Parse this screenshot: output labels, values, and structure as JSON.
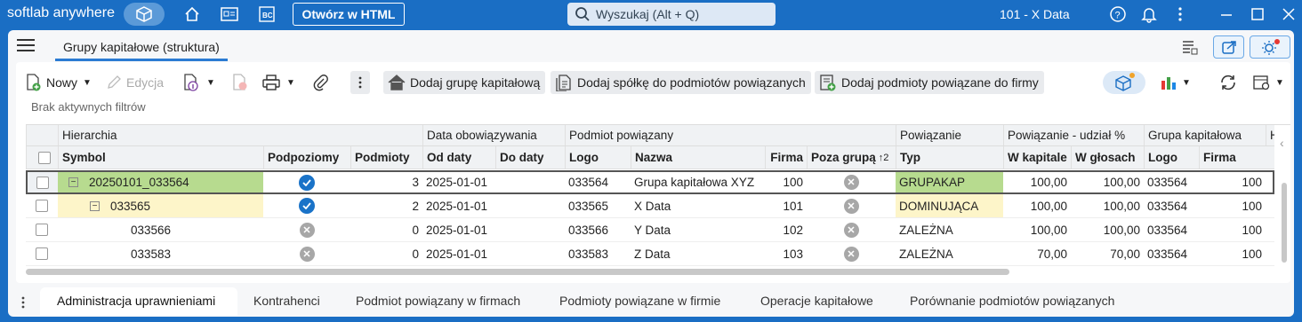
{
  "titlebar": {
    "brand": "softlab anywhere",
    "open_html_label": "Otwórz w HTML",
    "search_placeholder": "Wyszukaj (Alt + Q)",
    "company": "101 - X Data"
  },
  "tabs": {
    "active": "Grupy kapitałowe (struktura)"
  },
  "toolbar": {
    "new_label": "Nowy",
    "edit_label": "Edycja",
    "add_group_label": "Dodaj grupę kapitałową",
    "add_company_label": "Dodaj spółkę do podmiotów powiązanych",
    "add_related_label": "Dodaj podmioty powiązane do firmy"
  },
  "filters_text": "Brak aktywnych filtrów",
  "grid": {
    "group_headers": {
      "hierarchy": "Hierarchia",
      "validity": "Data obowiązywania",
      "related": "Podmiot powiązany",
      "relation": "Powiązanie",
      "share": "Powiązanie - udział %",
      "group": "Grupa kapitałowa",
      "extra": "H"
    },
    "columns": {
      "symbol": "Symbol",
      "sublevels": "Podpoziomy",
      "entities": "Podmioty",
      "from": "Od daty",
      "to": "Do daty",
      "logo": "Logo",
      "name": "Nazwa",
      "firm": "Firma",
      "outside": "Poza grupą",
      "type": "Typ",
      "capital": "W kapitale",
      "votes": "W głosach",
      "glogo": "Logo",
      "gfirm": "Firma"
    },
    "rows": [
      {
        "symbol": "20250101_033564",
        "sublevels": "yes",
        "entities": "3",
        "from": "2025-01-01",
        "to": "",
        "logo": "033564",
        "name": "Grupa kapitałowa XYZ",
        "firm": "100",
        "outside": "no",
        "type": "GRUPAKAP",
        "capital": "100,00",
        "votes": "100,00",
        "glogo": "033564",
        "gfirm": "100"
      },
      {
        "symbol": "033565",
        "sublevels": "yes",
        "entities": "2",
        "from": "2025-01-01",
        "to": "",
        "logo": "033565",
        "name": "X Data",
        "firm": "101",
        "outside": "no",
        "type": "DOMINUJĄCA",
        "capital": "100,00",
        "votes": "100,00",
        "glogo": "033564",
        "gfirm": "100"
      },
      {
        "symbol": "033566",
        "sublevels": "no",
        "entities": "0",
        "from": "2025-01-01",
        "to": "",
        "logo": "033566",
        "name": "Y Data",
        "firm": "102",
        "outside": "no",
        "type": "ZALEŻNA",
        "capital": "100,00",
        "votes": "100,00",
        "glogo": "033564",
        "gfirm": "100"
      },
      {
        "symbol": "033583",
        "sublevels": "no",
        "entities": "0",
        "from": "2025-01-01",
        "to": "",
        "logo": "033583",
        "name": "Z Data",
        "firm": "103",
        "outside": "no",
        "type": "ZALEŻNA",
        "capital": "70,00",
        "votes": "70,00",
        "glogo": "033564",
        "gfirm": "100"
      }
    ]
  },
  "bottom_tabs": [
    "Administracja uprawnieniami",
    "Kontrahenci",
    "Podmiot powiązany w firmach",
    "Podmioty powiązane w firmie",
    "Operacje kapitałowe",
    "Porównanie podmiotów powiązanych"
  ],
  "colors": {
    "accent": "#1a6ec4",
    "group_row": "#b7db8f",
    "dominant_row": "#fdf5c9"
  }
}
